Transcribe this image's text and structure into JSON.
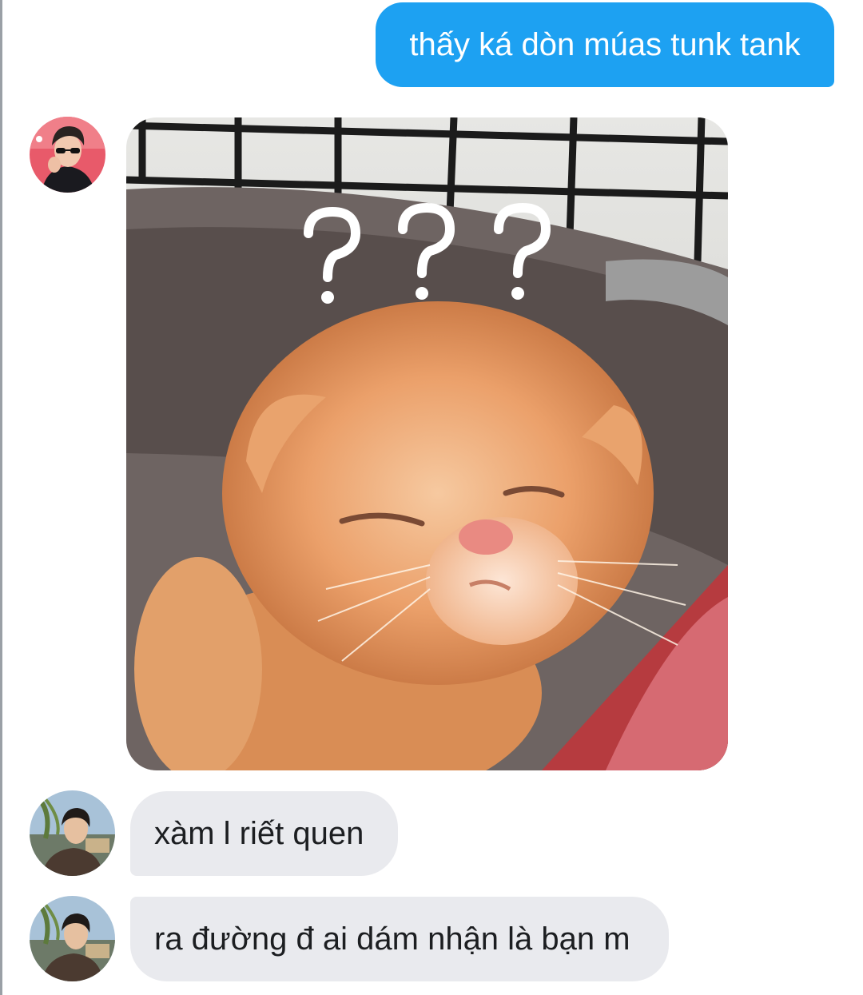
{
  "conversation": {
    "messages": [
      {
        "direction": "outgoing",
        "type": "text",
        "text": "thấy ká dòn múas tunk tank"
      },
      {
        "direction": "incoming",
        "type": "image",
        "sender_avatar": "avatar-sunglasses",
        "image_subject": "sleepy-kitten-question-marks",
        "overlay_text": "? ? ?"
      },
      {
        "direction": "incoming",
        "type": "text",
        "text": "xàm l riết quen"
      },
      {
        "direction": "incoming",
        "type": "text",
        "text": "ra đường đ ai dám nhận là bạn m"
      }
    ]
  },
  "colors": {
    "outgoing_bubble": "#1da1f2",
    "incoming_bubble": "#e9eaee",
    "background": "#ffffff"
  }
}
